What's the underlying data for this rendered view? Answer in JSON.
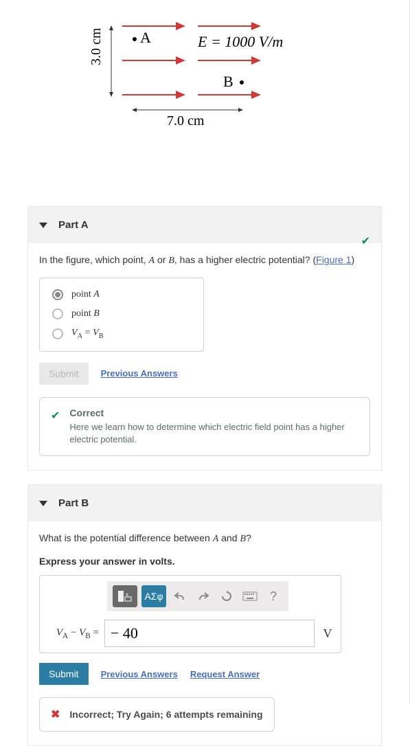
{
  "figure": {
    "y_label": "3.0 cm",
    "x_label": "7.0 cm",
    "point_a": "A",
    "point_b": "B",
    "field_eq": "E = 1000 V/m"
  },
  "partA": {
    "title": "Part A",
    "question_prefix": "In the figure, which point, ",
    "math_a": "A",
    "or_text": " or ",
    "math_b": "B",
    "question_suffix": ", has a higher electric potential? (",
    "fig_link": "Figure 1",
    "question_end": ")",
    "options": {
      "a_prefix": "point ",
      "a_math": "A",
      "b_prefix": "point ",
      "b_math": "B",
      "c_va": "V",
      "c_suba": "A",
      "c_eq": " = ",
      "c_vb": "V",
      "c_subb": "B"
    },
    "submit": "Submit",
    "prev": "Previous Answers",
    "feedback": {
      "title": "Correct",
      "text": "Here we learn how to determine which electric field point has a higher electric potential."
    }
  },
  "partB": {
    "title": "Part B",
    "q_prefix": "What is the potential difference between ",
    "math_a": "A",
    "q_mid": " and ",
    "math_b": "B",
    "q_end": "?",
    "instructions": "Express your answer in volts.",
    "toolbar": {
      "greek": "ΑΣφ",
      "undo": "↶",
      "redo": "↷",
      "reset": "↻",
      "help": "?"
    },
    "lhs_va": "V",
    "lhs_suba": "A",
    "lhs_minus": " − ",
    "lhs_vb": "V",
    "lhs_subb": "B",
    "lhs_eq": " =",
    "value": "− 40",
    "unit": "V",
    "submit": "Submit",
    "prev": "Previous Answers",
    "req": "Request Answer",
    "incorrect": "Incorrect; Try Again; 6 attempts remaining"
  }
}
